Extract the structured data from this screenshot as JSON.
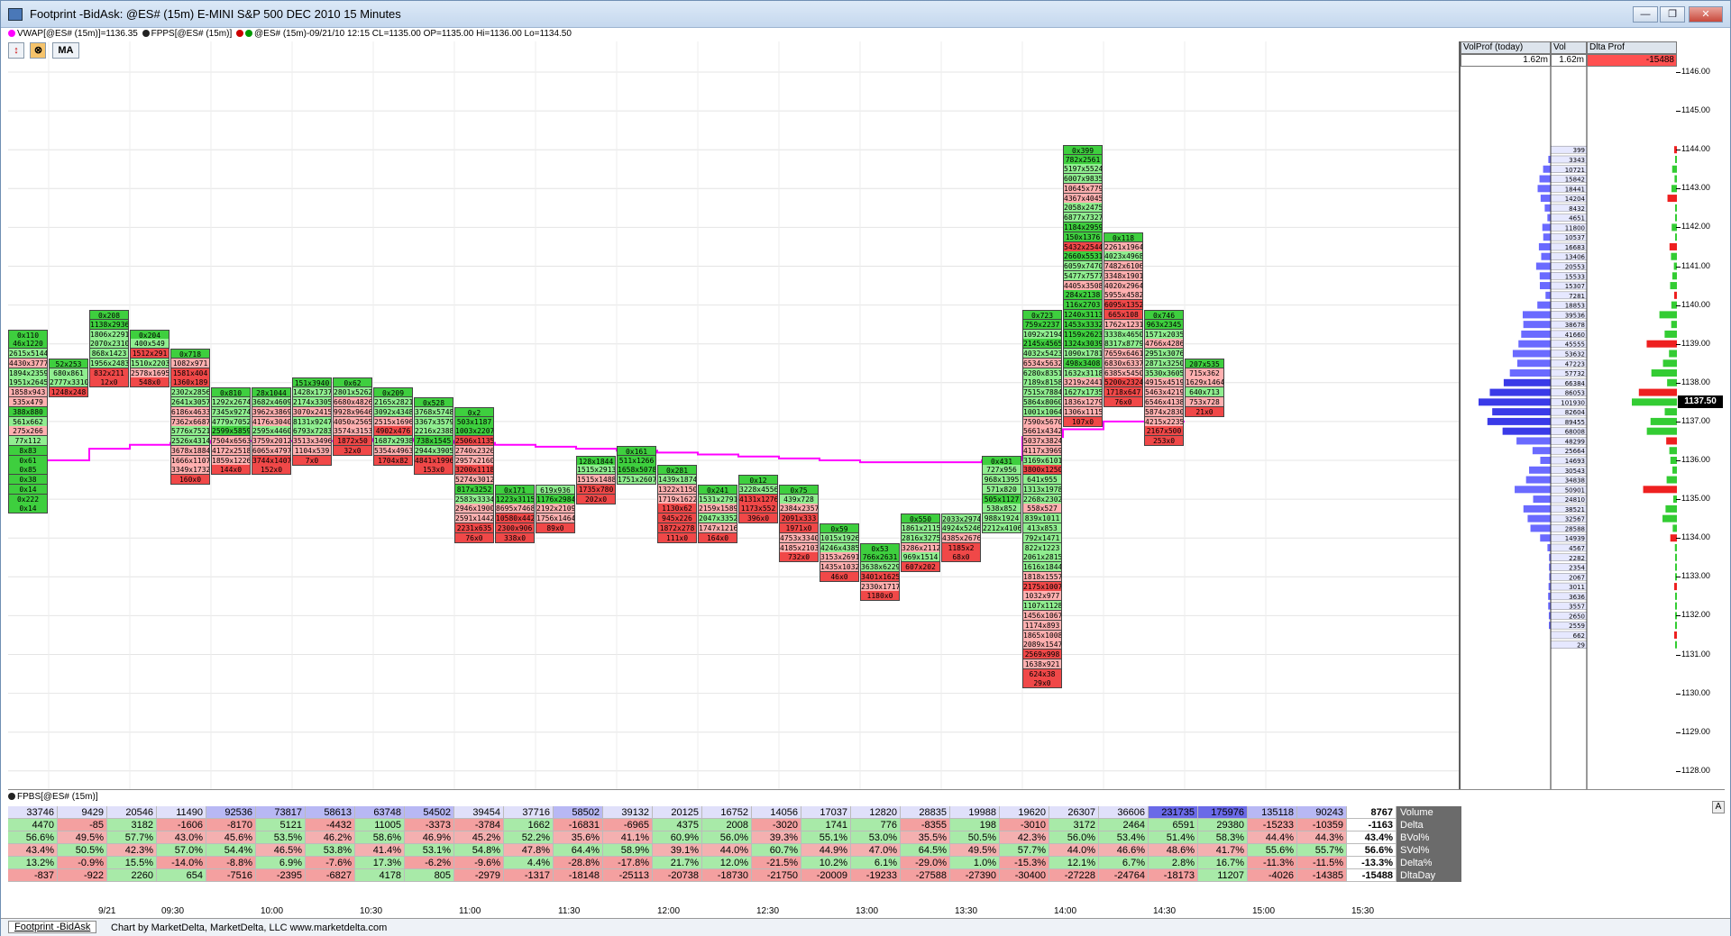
{
  "window": {
    "title": "Footprint  -BidAsk: @ES# (15m) E-MINI S&P 500 DEC 2010 15 Minutes",
    "buttons": {
      "minimize": "—",
      "restore": "❐",
      "close": "✕"
    }
  },
  "infobar": {
    "vwap": "VWAP[@ES# (15m)]=1136.35",
    "fpps": "FPPS[@ES# (15m)]",
    "ohlc": "@ES# (15m)-09/21/10 12:15 CL=1135.00 OP=1135.00 Hi=1136.00 Lo=1134.50"
  },
  "toolbar": {
    "ma_label": "MA"
  },
  "colors": {
    "ask": "#90ee90",
    "bid": "#ff8080",
    "vwap": "#ff00ff",
    "profile_vol": "#6a6aff",
    "profile_delta_pos": "#33cc33",
    "profile_delta_neg": "#ee2020"
  },
  "volume_profile": {
    "headers": [
      "VolProf (today)",
      "Vol",
      "Dlta Prof"
    ],
    "values": [
      "1.62m",
      "1.62m",
      "-15488"
    ],
    "profile_labels": [
      "399",
      "3343",
      "10721",
      "15842",
      "18441",
      "14204",
      "8432",
      "4651",
      "11800",
      "10537",
      "16683",
      "13406",
      "20553",
      "15533",
      "15307",
      "7281",
      "18853",
      "39536",
      "38678",
      "41660",
      "45555",
      "53632",
      "47223",
      "57732",
      "66384",
      "86053",
      "101930",
      "82604",
      "89455",
      "68008",
      "48299",
      "25664",
      "14693",
      "30543",
      "34838",
      "50901",
      "24810",
      "38521",
      "32567",
      "28588",
      "14939",
      "4567",
      "2282",
      "2354",
      "2067",
      "3011",
      "3636",
      "3557",
      "2650",
      "2559",
      "662",
      "29"
    ]
  },
  "price_axis": {
    "ticks": [
      "1146.00",
      "1145.00",
      "1144.00",
      "1143.00",
      "1142.00",
      "1141.00",
      "1140.00",
      "1139.00",
      "1138.00",
      "1137.00",
      "1136.00",
      "1135.00",
      "1134.00",
      "1133.00",
      "1132.00",
      "1131.00",
      "1130.00",
      "1129.00",
      "1128.00"
    ],
    "current_price": "1137.50"
  },
  "chart_data": {
    "type": "table",
    "title": "Footprint  -BidAsk: @ES# (15m) E-MINI S&P 500 DEC 2010 15 Minutes",
    "price_tick": 0.25,
    "time_labels": [
      "9/21",
      "09:30",
      "10:00",
      "10:30",
      "11:00",
      "11:30",
      "12:00",
      "12:30",
      "13:00",
      "13:30",
      "14:00",
      "14:30",
      "15:00",
      "15:30"
    ],
    "bars": [
      {
        "top": 1139.25,
        "cells": [
          "0x110",
          "46x1220",
          "2615x5144",
          "4430x3777",
          "1894x2359",
          "1951x2645",
          "1858x943",
          "535x479",
          "388x880",
          "561x662",
          "275x266",
          "77x112",
          "8x83",
          "0x61",
          "0x85",
          "0x38",
          "0x14",
          "0x222",
          "0x14"
        ]
      },
      {
        "top": 1138.5,
        "cells": [
          "52x253",
          "680x861",
          "2777x3310",
          "1248x248"
        ]
      },
      {
        "top": 1139.75,
        "cells": [
          "0x208",
          "1138x2936",
          "1806x2291",
          "2070x2310",
          "868x1423",
          "1956x2483",
          "832x211",
          "12x0"
        ]
      },
      {
        "top": 1139.25,
        "cells": [
          "0x204",
          "400x549",
          "1512x291",
          "1510x2203",
          "2578x1695",
          "548x0"
        ]
      },
      {
        "top": 1138.75,
        "cells": [
          "0x718",
          "1082x971",
          "1581x404",
          "1360x189",
          "2302x2856",
          "2641x3057",
          "6186x4633",
          "7362x6687",
          "5776x7521",
          "2526x4314",
          "3678x1884",
          "1666x1107",
          "3349x1732",
          "160x0"
        ]
      },
      {
        "top": 1137.75,
        "cells": [
          "0x810",
          "1292x2674",
          "7345x9274",
          "4779x7052",
          "2599x5859",
          "7504x6563",
          "4172x2518",
          "1859x1226",
          "144x0"
        ]
      },
      {
        "top": 1137.75,
        "cells": [
          "28x1044",
          "3682x4609",
          "3962x3869",
          "4176x3040",
          "2595x4460",
          "3759x2012",
          "6065x4797",
          "3744x1407",
          "152x0"
        ]
      },
      {
        "top": 1138.0,
        "cells": [
          "151x3940",
          "1428x1737",
          "2174x3305",
          "3070x2415",
          "8131x9247",
          "6793x7283",
          "3513x3496",
          "1104x539",
          "7x0"
        ]
      },
      {
        "top": 1138.0,
        "cells": [
          "0x62",
          "2801x5262",
          "6680x4826",
          "9928x9646",
          "4050x2565",
          "3574x3153",
          "1872x50",
          "32x0"
        ]
      },
      {
        "top": 1137.75,
        "cells": [
          "0x209",
          "2165x2821",
          "3092x4348",
          "2515x1696",
          "4902x476",
          "1687x2938",
          "5354x4963",
          "1704x82"
        ]
      },
      {
        "top": 1137.5,
        "cells": [
          "0x528",
          "3768x5748",
          "3367x3579",
          "2216x2388",
          "738x1545",
          "2944x3905",
          "4841x1996",
          "153x0"
        ]
      },
      {
        "top": 1137.25,
        "cells": [
          "0x2",
          "503x1187",
          "1003x2207",
          "2506x1135",
          "2740x2326",
          "2957x2160",
          "3200x1118",
          "5274x3012",
          "817x3252",
          "2583x3334",
          "2946x1900",
          "2591x1442",
          "2231x635",
          "76x0"
        ]
      },
      {
        "top": 1135.25,
        "cells": [
          "0x171",
          "1223x3115",
          "8695x7468",
          "10580x4422",
          "2300x906",
          "338x0"
        ]
      },
      {
        "top": 1135.25,
        "cells": [
          "619x936",
          "1176x2984",
          "2192x2109",
          "1756x1464",
          "89x0"
        ]
      },
      {
        "top": 1136.0,
        "cells": [
          "128x1844",
          "1515x2913",
          "1515x1488",
          "1735x780",
          "202x0"
        ]
      },
      {
        "top": 1136.25,
        "cells": [
          "0x161",
          "511x1266",
          "1658x5078",
          "1751x2607"
        ]
      },
      {
        "top": 1135.75,
        "cells": [
          "0x281",
          "1439x1874",
          "1322x1150",
          "1719x1622",
          "1130x62",
          "945x226",
          "1872x278",
          "111x0"
        ]
      },
      {
        "top": 1135.25,
        "cells": [
          "0x241",
          "1531x2791",
          "2159x1589",
          "2047x3352",
          "1747x1216",
          "164x0"
        ]
      },
      {
        "top": 1135.5,
        "cells": [
          "0x12",
          "3228x4556",
          "4131x1276",
          "1173x552",
          "396x0"
        ]
      },
      {
        "top": 1135.25,
        "cells": [
          "0x75",
          "439x728",
          "2384x2357",
          "2091x333",
          "1971x0",
          "4753x3340",
          "4185x2103",
          "732x0"
        ]
      },
      {
        "top": 1134.25,
        "cells": [
          "0x59",
          "1015x1926",
          "4246x4385",
          "3153x2691",
          "1435x1032",
          "46x0"
        ]
      },
      {
        "top": 1133.75,
        "cells": [
          "0x53",
          "766x2631",
          "3638x6229",
          "3401x1625",
          "2330x1717",
          "1180x0"
        ]
      },
      {
        "top": 1134.5,
        "cells": [
          "0x550",
          "1861x2115",
          "2816x3275",
          "3286x2112",
          "969x1514",
          "607x202"
        ]
      },
      {
        "top": 1134.5,
        "cells": [
          "2033x2974",
          "4924x5246",
          "4385x2676",
          "1185x2",
          "68x0"
        ]
      },
      {
        "top": 1136.0,
        "cells": [
          "0x431",
          "727x956",
          "968x1395",
          "571x820",
          "505x1127",
          "538x852",
          "988x1924",
          "2212x4106"
        ]
      },
      {
        "top": 1139.75,
        "cells": [
          "0x723",
          "759x2237",
          "1092x2194",
          "2145x4565",
          "4032x5423",
          "6534x5632",
          "6280x8351",
          "7189x8158",
          "7515x7884",
          "5864x8060",
          "1001x1064",
          "7590x5670",
          "5661x4342",
          "5037x3824",
          "4117x3969",
          "3169x6101",
          "3800x1250",
          "641x955",
          "1313x1978",
          "2268x2302",
          "558x527",
          "839x1011",
          "413x853",
          "792x1471",
          "822x1223",
          "2061x2815",
          "1616x1844",
          "1818x1557",
          "2175x1007",
          "1032x977",
          "1107x1128",
          "1456x1067",
          "1174x893",
          "1865x1008",
          "2089x1547",
          "2569x998",
          "1638x921",
          "624x38",
          "29x0"
        ]
      },
      {
        "top": 1144.0,
        "cells": [
          "0x399",
          "782x2561",
          "5197x5524",
          "6007x9835",
          "10645x7796",
          "4367x4045",
          "2058x2475",
          "6877x7327",
          "1184x2959",
          "150x1376",
          "5432x2544",
          "2660x5531",
          "6059x7470",
          "5477x7577",
          "4405x3508",
          "284x2138",
          "116x2703",
          "1240x3113",
          "1453x3332",
          "1159x2623",
          "1324x3039",
          "1090x1781",
          "498x3408",
          "1632x3118",
          "3219x2441",
          "1627x1735",
          "1836x1279",
          "1306x1115",
          "107x0"
        ]
      },
      {
        "top": 1141.75,
        "cells": [
          "0x118",
          "2261x1964",
          "4023x4968",
          "7482x6106",
          "3348x1901",
          "4020x2964",
          "5955x4582",
          "6095x1352",
          "665x108",
          "1762x1231",
          "3338x4650",
          "8317x8779",
          "7659x6461",
          "6830x6337",
          "6385x5450",
          "5200x2324",
          "1718x647",
          "76x0"
        ]
      },
      {
        "top": 1139.75,
        "cells": [
          "0x746",
          "963x2345",
          "1571x2035",
          "4766x4286",
          "2951x3076",
          "2871x3250",
          "3530x3605",
          "4915x4519",
          "5463x4219",
          "6546x4138",
          "5874x2830",
          "4215x2235",
          "2167x500",
          "253x0"
        ]
      },
      {
        "top": 1138.5,
        "cells": [
          "207x535",
          "715x362",
          "1629x1464",
          "640x713",
          "753x728",
          "21x0"
        ]
      }
    ],
    "vwap": [
      1136.0,
      1136.0,
      1136.3,
      1136.4,
      1136.45,
      1136.5,
      1136.5,
      1136.5,
      1136.5,
      1136.55,
      1136.5,
      1136.45,
      1136.4,
      1136.35,
      1136.3,
      1136.25,
      1136.2,
      1136.15,
      1136.1,
      1136.05,
      1136.0,
      1135.95,
      1135.95,
      1135.95,
      1136.0,
      1136.6,
      1136.8,
      1137.0,
      1137.0
    ],
    "lower_panel": {
      "label": "FPBS[@ES# (15m)]",
      "row_labels": [
        "Volume",
        "Delta",
        "BVol%",
        "SVol%",
        "Delta%",
        "DltaDay"
      ],
      "rows": [
        [
          "33746",
          "9429",
          "20546",
          "11490",
          "92536",
          "73817",
          "58613",
          "63748",
          "54502",
          "39454",
          "37716",
          "58502",
          "39132",
          "20125",
          "16752",
          "14056",
          "17037",
          "12820",
          "28835",
          "19988",
          "19620",
          "26307",
          "36606",
          "231735",
          "175976",
          "135118",
          "90243",
          "8767"
        ],
        [
          "4470",
          "-85",
          "3182",
          "-1606",
          "-8170",
          "5121",
          "-4432",
          "11005",
          "-3373",
          "-3784",
          "1662",
          "-16831",
          "-6965",
          "4375",
          "2008",
          "-3020",
          "1741",
          "776",
          "-8355",
          "198",
          "-3010",
          "3172",
          "2464",
          "6591",
          "29380",
          "-15233",
          "-10359",
          "-1163"
        ],
        [
          "56.6%",
          "49.5%",
          "57.7%",
          "43.0%",
          "45.6%",
          "53.5%",
          "46.2%",
          "58.6%",
          "46.9%",
          "45.2%",
          "52.2%",
          "35.6%",
          "41.1%",
          "60.9%",
          "56.0%",
          "39.3%",
          "55.1%",
          "53.0%",
          "35.5%",
          "50.5%",
          "42.3%",
          "56.0%",
          "53.4%",
          "51.4%",
          "58.3%",
          "44.4%",
          "44.3%",
          "43.4%"
        ],
        [
          "43.4%",
          "50.5%",
          "42.3%",
          "57.0%",
          "54.4%",
          "46.5%",
          "53.8%",
          "41.4%",
          "53.1%",
          "54.8%",
          "47.8%",
          "64.4%",
          "58.9%",
          "39.1%",
          "44.0%",
          "60.7%",
          "44.9%",
          "47.0%",
          "64.5%",
          "49.5%",
          "57.7%",
          "44.0%",
          "46.6%",
          "48.6%",
          "41.7%",
          "55.6%",
          "55.7%",
          "56.6%"
        ],
        [
          "13.2%",
          "-0.9%",
          "15.5%",
          "-14.0%",
          "-8.8%",
          "6.9%",
          "-7.6%",
          "17.3%",
          "-6.2%",
          "-9.6%",
          "4.4%",
          "-28.8%",
          "-17.8%",
          "21.7%",
          "12.0%",
          "-21.5%",
          "10.2%",
          "6.1%",
          "-29.0%",
          "1.0%",
          "-15.3%",
          "12.1%",
          "6.7%",
          "2.8%",
          "16.7%",
          "-11.3%",
          "-11.5%",
          "-13.3%"
        ],
        [
          "-837",
          "-922",
          "2260",
          "654",
          "-7516",
          "-2395",
          "-6827",
          "4178",
          "805",
          "-2979",
          "-1317",
          "-18148",
          "-25113",
          "-20738",
          "-18730",
          "-21750",
          "-20009",
          "-19233",
          "-27588",
          "-27390",
          "-30400",
          "-27228",
          "-24764",
          "-18173",
          "11207",
          "-4026",
          "-14385",
          "-15488"
        ]
      ]
    }
  },
  "footer": {
    "tab": "Footprint  -BidAsk",
    "note": "Chart by MarketDelta, MarketDelta, LLC www.marketdelta.com"
  },
  "scroll_label": "A"
}
